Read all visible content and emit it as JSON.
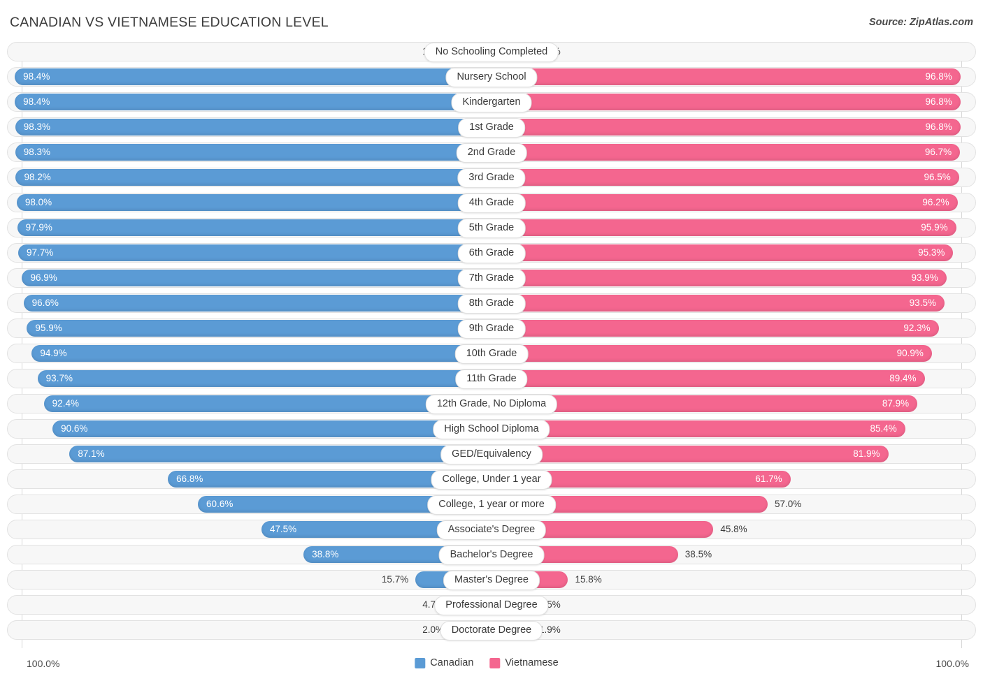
{
  "header": {
    "title": "CANADIAN VS VIETNAMESE EDUCATION LEVEL",
    "source": "Source: ZipAtlas.com"
  },
  "legend": {
    "items": [
      {
        "label": "Canadian",
        "color": "#5b9bd5"
      },
      {
        "label": "Vietnamese",
        "color": "#f4668f"
      }
    ]
  },
  "axis": {
    "left_label": "100.0%",
    "right_label": "100.0%"
  },
  "colors": {
    "canadian": "#5b9bd5",
    "vietnamese": "#f4668f",
    "canadian_light": "#a6c8e8",
    "vietnamese_light": "#f4a0be",
    "track": "#f7f7f7",
    "track_border": "#e2e2e2"
  },
  "chart_data": {
    "type": "bar",
    "title": "CANADIAN VS VIETNAMESE EDUCATION LEVEL",
    "subtitle": "Source: ZipAtlas.com",
    "orientation": "horizontal-diverging",
    "xlabel": "",
    "ylabel": "",
    "xlim": [
      0,
      100
    ],
    "grid": true,
    "legend_position": "bottom-center",
    "categories": [
      "No Schooling Completed",
      "Nursery School",
      "Kindergarten",
      "1st Grade",
      "2nd Grade",
      "3rd Grade",
      "4th Grade",
      "5th Grade",
      "6th Grade",
      "7th Grade",
      "8th Grade",
      "9th Grade",
      "10th Grade",
      "11th Grade",
      "12th Grade, No Diploma",
      "High School Diploma",
      "GED/Equivalency",
      "College, Under 1 year",
      "College, 1 year or more",
      "Associate's Degree",
      "Bachelor's Degree",
      "Master's Degree",
      "Professional Degree",
      "Doctorate Degree"
    ],
    "series": [
      {
        "name": "Canadian",
        "color": "#5b9bd5",
        "values": [
          1.7,
          98.4,
          98.4,
          98.3,
          98.3,
          98.2,
          98.0,
          97.9,
          97.7,
          96.9,
          96.6,
          95.9,
          94.9,
          93.7,
          92.4,
          90.6,
          87.1,
          66.8,
          60.6,
          47.5,
          38.8,
          15.7,
          4.7,
          2.0
        ]
      },
      {
        "name": "Vietnamese",
        "color": "#f4668f",
        "values": [
          3.2,
          96.8,
          96.8,
          96.8,
          96.7,
          96.5,
          96.2,
          95.9,
          95.3,
          93.9,
          93.5,
          92.3,
          90.9,
          89.4,
          87.9,
          85.4,
          81.9,
          61.7,
          57.0,
          45.8,
          38.5,
          15.8,
          4.5,
          1.9
        ]
      }
    ]
  },
  "rows": [
    {
      "label": "No Schooling Completed",
      "left": "1.7%",
      "right": "3.2%",
      "left_val": 1.7,
      "right_val": 3.2
    },
    {
      "label": "Nursery School",
      "left": "98.4%",
      "right": "96.8%",
      "left_val": 98.4,
      "right_val": 96.8
    },
    {
      "label": "Kindergarten",
      "left": "98.4%",
      "right": "96.8%",
      "left_val": 98.4,
      "right_val": 96.8
    },
    {
      "label": "1st Grade",
      "left": "98.3%",
      "right": "96.8%",
      "left_val": 98.3,
      "right_val": 96.8
    },
    {
      "label": "2nd Grade",
      "left": "98.3%",
      "right": "96.7%",
      "left_val": 98.3,
      "right_val": 96.7
    },
    {
      "label": "3rd Grade",
      "left": "98.2%",
      "right": "96.5%",
      "left_val": 98.2,
      "right_val": 96.5
    },
    {
      "label": "4th Grade",
      "left": "98.0%",
      "right": "96.2%",
      "left_val": 98.0,
      "right_val": 96.2
    },
    {
      "label": "5th Grade",
      "left": "97.9%",
      "right": "95.9%",
      "left_val": 97.9,
      "right_val": 95.9
    },
    {
      "label": "6th Grade",
      "left": "97.7%",
      "right": "95.3%",
      "left_val": 97.7,
      "right_val": 95.3
    },
    {
      "label": "7th Grade",
      "left": "96.9%",
      "right": "93.9%",
      "left_val": 96.9,
      "right_val": 93.9
    },
    {
      "label": "8th Grade",
      "left": "96.6%",
      "right": "93.5%",
      "left_val": 96.6,
      "right_val": 93.5
    },
    {
      "label": "9th Grade",
      "left": "95.9%",
      "right": "92.3%",
      "left_val": 95.9,
      "right_val": 92.3
    },
    {
      "label": "10th Grade",
      "left": "94.9%",
      "right": "90.9%",
      "left_val": 94.9,
      "right_val": 90.9
    },
    {
      "label": "11th Grade",
      "left": "93.7%",
      "right": "89.4%",
      "left_val": 93.7,
      "right_val": 89.4
    },
    {
      "label": "12th Grade, No Diploma",
      "left": "92.4%",
      "right": "87.9%",
      "left_val": 92.4,
      "right_val": 87.9
    },
    {
      "label": "High School Diploma",
      "left": "90.6%",
      "right": "85.4%",
      "left_val": 90.6,
      "right_val": 85.4
    },
    {
      "label": "GED/Equivalency",
      "left": "87.1%",
      "right": "81.9%",
      "left_val": 87.1,
      "right_val": 81.9
    },
    {
      "label": "College, Under 1 year",
      "left": "66.8%",
      "right": "61.7%",
      "left_val": 66.8,
      "right_val": 61.7
    },
    {
      "label": "College, 1 year or more",
      "left": "60.6%",
      "right": "57.0%",
      "left_val": 60.6,
      "right_val": 57.0
    },
    {
      "label": "Associate's Degree",
      "left": "47.5%",
      "right": "45.8%",
      "left_val": 47.5,
      "right_val": 45.8
    },
    {
      "label": "Bachelor's Degree",
      "left": "38.8%",
      "right": "38.5%",
      "left_val": 38.8,
      "right_val": 38.5
    },
    {
      "label": "Master's Degree",
      "left": "15.7%",
      "right": "15.8%",
      "left_val": 15.7,
      "right_val": 15.8
    },
    {
      "label": "Professional Degree",
      "left": "4.7%",
      "right": "4.5%",
      "left_val": 4.7,
      "right_val": 4.5
    },
    {
      "label": "Doctorate Degree",
      "left": "2.0%",
      "right": "1.9%",
      "left_val": 2.0,
      "right_val": 1.9
    }
  ]
}
